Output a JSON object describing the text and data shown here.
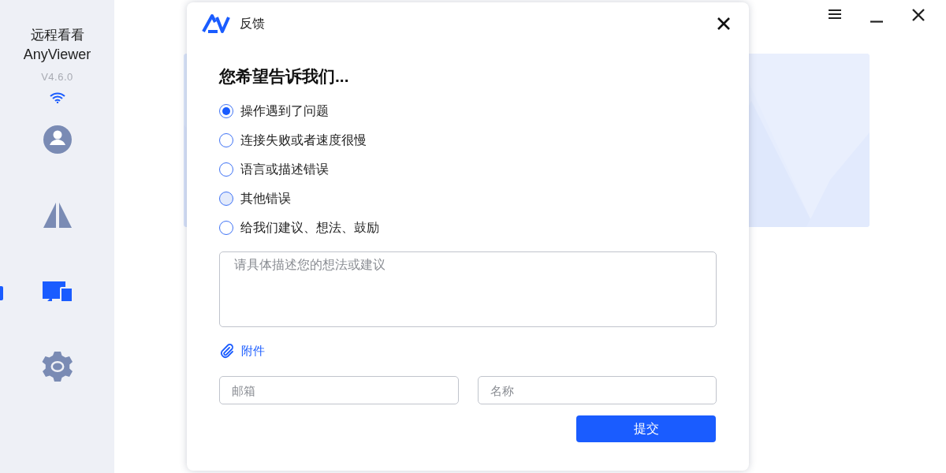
{
  "app": {
    "name": "远程看看",
    "brand": "AnyViewer",
    "version": "V4.6.0"
  },
  "nav": [
    {
      "kind": "account",
      "selected": false
    },
    {
      "kind": "mirror",
      "selected": false
    },
    {
      "kind": "devices",
      "selected": true
    },
    {
      "kind": "settings",
      "selected": false
    }
  ],
  "dialog": {
    "title": "反馈",
    "heading": "您希望告诉我们...",
    "options": [
      {
        "label": "操作遇到了问题",
        "selected": true,
        "hovered": false
      },
      {
        "label": "连接失败或者速度很慢",
        "selected": false,
        "hovered": false
      },
      {
        "label": "语言或描述错误",
        "selected": false,
        "hovered": false
      },
      {
        "label": "其他错误",
        "selected": false,
        "hovered": true
      },
      {
        "label": "给我们建议、想法、鼓励",
        "selected": false,
        "hovered": false
      }
    ],
    "description": {
      "placeholder": "请具体描述您的想法或建议"
    },
    "attachment": "附件",
    "email": {
      "placeholder": "邮箱"
    },
    "name": {
      "placeholder": "名称"
    },
    "submit": "提交"
  }
}
